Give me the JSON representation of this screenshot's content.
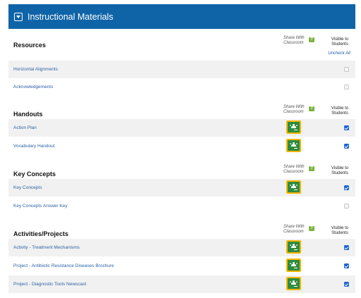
{
  "panel": {
    "title": "Instructional Materials",
    "header_color": "#0f64a8"
  },
  "columns": {
    "share_with_classroom": "Share With Classroom",
    "help": "?",
    "visible_to_students": "Visible to Students",
    "uncheck_all": "Uncheck All"
  },
  "sections": [
    {
      "title": "Resources",
      "items": [
        {
          "label": "Horizontal Alignments",
          "classroom": false,
          "visible": false
        },
        {
          "label": "Acknowledgements",
          "classroom": false,
          "visible": false
        }
      ]
    },
    {
      "title": "Handouts",
      "items": [
        {
          "label": "Action Plan",
          "classroom": true,
          "visible": true
        },
        {
          "label": "Vocabulary Handout",
          "classroom": true,
          "visible": true
        }
      ]
    },
    {
      "title": "Key Concepts",
      "items": [
        {
          "label": "Key Concepts",
          "classroom": true,
          "visible": true
        },
        {
          "label": "Key Concepts Answer Key",
          "classroom": false,
          "visible": false
        }
      ]
    },
    {
      "title": "Activities/Projects",
      "items": [
        {
          "label": "Activity - Treatment Mechanisms",
          "classroom": true,
          "visible": true
        },
        {
          "label": "Project - Antibiotic Resistance Diseases Brochure",
          "classroom": true,
          "visible": true
        },
        {
          "label": "Project - Diagnostic Tools Newscast",
          "classroom": true,
          "visible": true
        }
      ]
    }
  ],
  "icons": {
    "collapse": "collapse-toggle-icon",
    "classroom": "google-classroom-icon",
    "help": "help-icon"
  }
}
